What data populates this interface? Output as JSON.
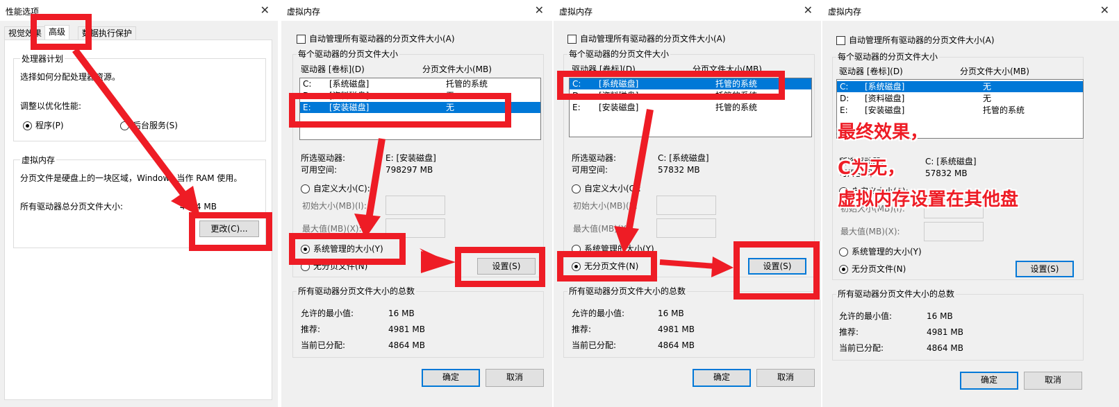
{
  "p1": {
    "title": "性能选项",
    "tabs": [
      "视觉效果",
      "高级",
      "数据执行保护"
    ],
    "cpu": {
      "heading": "处理器计划",
      "desc": "选择如何分配处理器资源。",
      "adjust": "调整以优化性能:",
      "opt1": "程序(P)",
      "opt2": "后台服务(S)"
    },
    "vm": {
      "heading": "虚拟内存",
      "desc": "分页文件是硬盘上的一块区域，Windows 当作 RAM 使用。",
      "total_label": "所有驱动器总分页文件大小:",
      "total_value": "4864 MB",
      "change_button": "更改(C)..."
    }
  },
  "vmd": {
    "title": "虚拟内存",
    "auto": "自动管理所有驱动器的分页文件大小(A)",
    "per_drive": "每个驱动器的分页文件大小",
    "col_drive": "驱动器 [卷标](D)",
    "col_size": "分页文件大小(MB)",
    "sel_drive_label": "所选驱动器:",
    "free_label": "可用空间:",
    "custom": "自定义大小(C):",
    "initial": "初始大小(MB)(I):",
    "max": "最大值(MB)(X):",
    "system_managed": "系统管理的大小(Y)",
    "no_paging": "无分页文件(N)",
    "set_button": "设置(S)",
    "totals_heading": "所有驱动器分页文件大小的总数",
    "min_label": "允许的最小值:",
    "min_value": "16 MB",
    "rec_label": "推荐:",
    "rec_value": "4981 MB",
    "cur_label": "当前已分配:",
    "cur_value": "4864 MB",
    "ok": "确定",
    "cancel": "取消"
  },
  "d2": {
    "rows": [
      {
        "drive": "C:",
        "label": "[系统磁盘]",
        "size": "托管的系统"
      },
      {
        "drive": "D:",
        "label": "[资料磁盘]",
        "size": "无"
      },
      {
        "drive": "E:",
        "label": "[安装磁盘]",
        "size": "无"
      }
    ],
    "sel_drive": "E:  [安装磁盘]",
    "free": "798297 MB"
  },
  "d3": {
    "rows": [
      {
        "drive": "C:",
        "label": "[系统磁盘]",
        "size": "托管的系统"
      },
      {
        "drive": "D:",
        "label": "[资料磁盘]",
        "size": "托管的系统"
      },
      {
        "drive": "E:",
        "label": "[安装磁盘]",
        "size": "托管的系统"
      }
    ],
    "sel_drive": "C:  [系统磁盘]",
    "free": "57832 MB"
  },
  "d4": {
    "rows": [
      {
        "drive": "C:",
        "label": "[系统磁盘]",
        "size": "无"
      },
      {
        "drive": "D:",
        "label": "[资料磁盘]",
        "size": "无"
      },
      {
        "drive": "E:",
        "label": "[安装磁盘]",
        "size": "托管的系统"
      }
    ],
    "sel_drive": "C:  [系统磁盘]",
    "free": "57832 MB"
  },
  "annotation": {
    "line1": "最终效果，",
    "line2": "C为无，",
    "line3": "虚拟内存设置在其他盘"
  },
  "colors": {
    "highlight": "#ee1c25",
    "selection": "#0078d7"
  }
}
